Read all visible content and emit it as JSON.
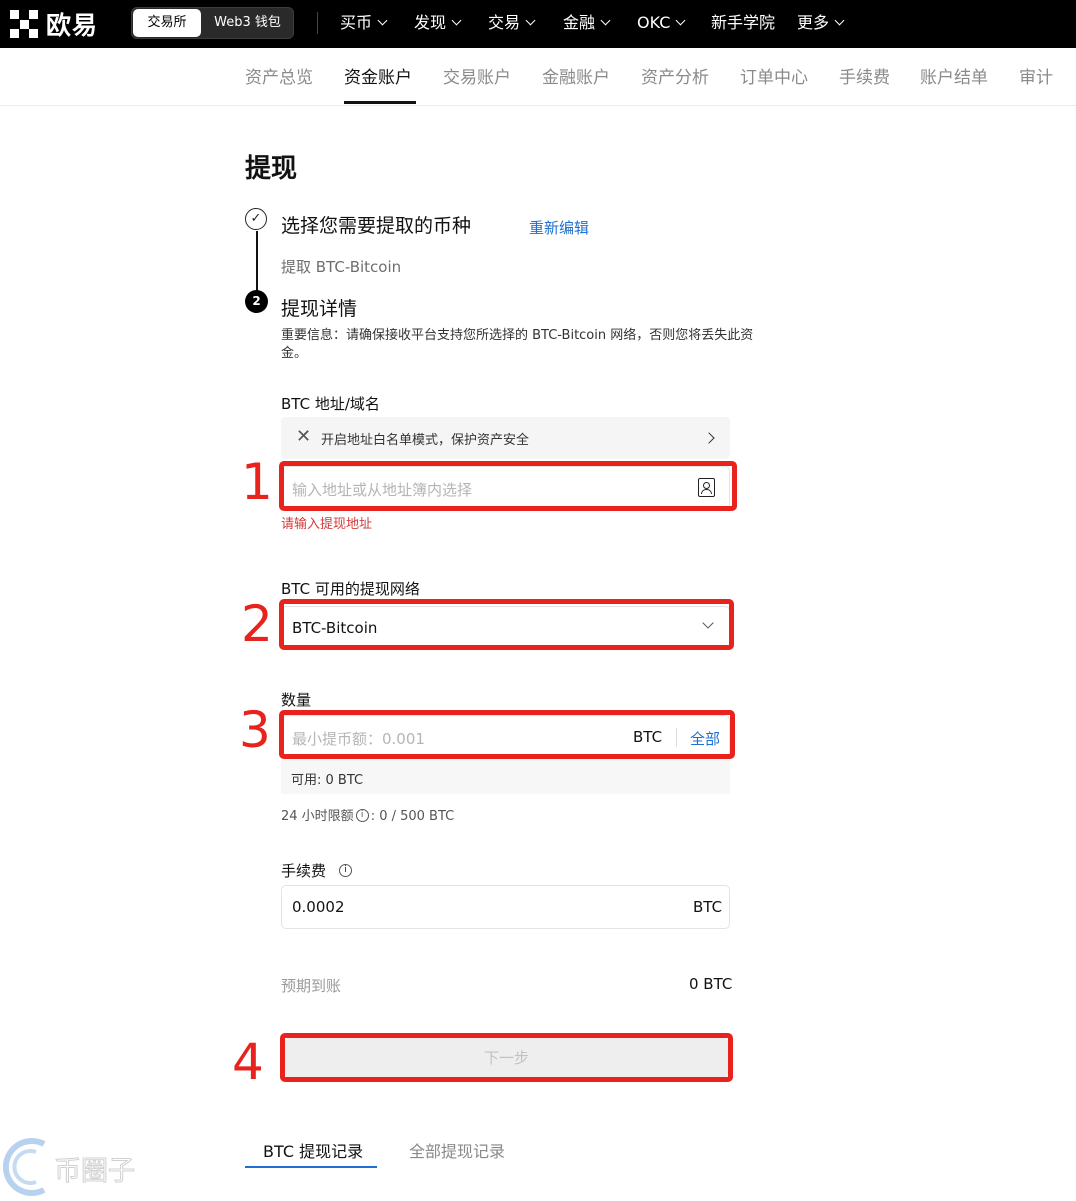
{
  "brand": {
    "name": "欧易"
  },
  "mode_switch": {
    "exchange": "交易所",
    "web3": "Web3 钱包"
  },
  "top_nav": {
    "items": [
      {
        "label": "买币",
        "has_dropdown": true
      },
      {
        "label": "发现",
        "has_dropdown": true
      },
      {
        "label": "交易",
        "has_dropdown": true
      },
      {
        "label": "金融",
        "has_dropdown": true
      },
      {
        "label": "OKC",
        "has_dropdown": true
      },
      {
        "label": "新手学院",
        "has_dropdown": false
      },
      {
        "label": "更多",
        "has_dropdown": true
      }
    ]
  },
  "sub_nav": {
    "active": "资金账户",
    "tabs": [
      "资产总览",
      "资金账户",
      "交易账户",
      "金融账户",
      "资产分析",
      "订单中心",
      "手续费",
      "账户结单",
      "审计"
    ]
  },
  "page": {
    "title": "提现"
  },
  "steps": {
    "step1": {
      "title": "选择您需要提取的币种",
      "edit_link": "重新编辑",
      "summary": "提取 BTC-Bitcoin",
      "status_icon": "check-icon"
    },
    "step2": {
      "number": "2",
      "title": "提现详情"
    }
  },
  "notice": "重要信息：请确保接收平台支持您所选择的 BTC-Bitcoin 网络，否则您将丢失此资金。",
  "address": {
    "label": "BTC 地址/域名",
    "whitelist_text": "开启地址白名单模式，保护资产安全",
    "placeholder": "输入地址或从地址簿内选择",
    "error": "请输入提现地址"
  },
  "network": {
    "label": "BTC 可用的提现网络",
    "selected": "BTC-Bitcoin"
  },
  "amount": {
    "label": "数量",
    "placeholder": "最小提币额：0.001",
    "unit": "BTC",
    "all_label": "全部",
    "available": "可用:  0 BTC",
    "limit_label": "24 小时限额",
    "limit_value": ": 0 / 500 BTC"
  },
  "fee": {
    "label": "手续费",
    "value": "0.0002",
    "unit": "BTC"
  },
  "expected": {
    "label": "预期到账",
    "value": "0 BTC"
  },
  "next_button": "下一步",
  "records": {
    "tabs": [
      "BTC 提现记录",
      "全部提现记录"
    ],
    "active": "BTC 提现记录"
  },
  "annotations": {
    "numbers": [
      "1",
      "2",
      "3",
      "4"
    ],
    "color": "#e8221d"
  },
  "watermark": {
    "text": "币圈子"
  },
  "colors": {
    "link_blue": "#1e6fcf",
    "error_red": "#d33a3a",
    "topbar_bg": "#000000"
  }
}
